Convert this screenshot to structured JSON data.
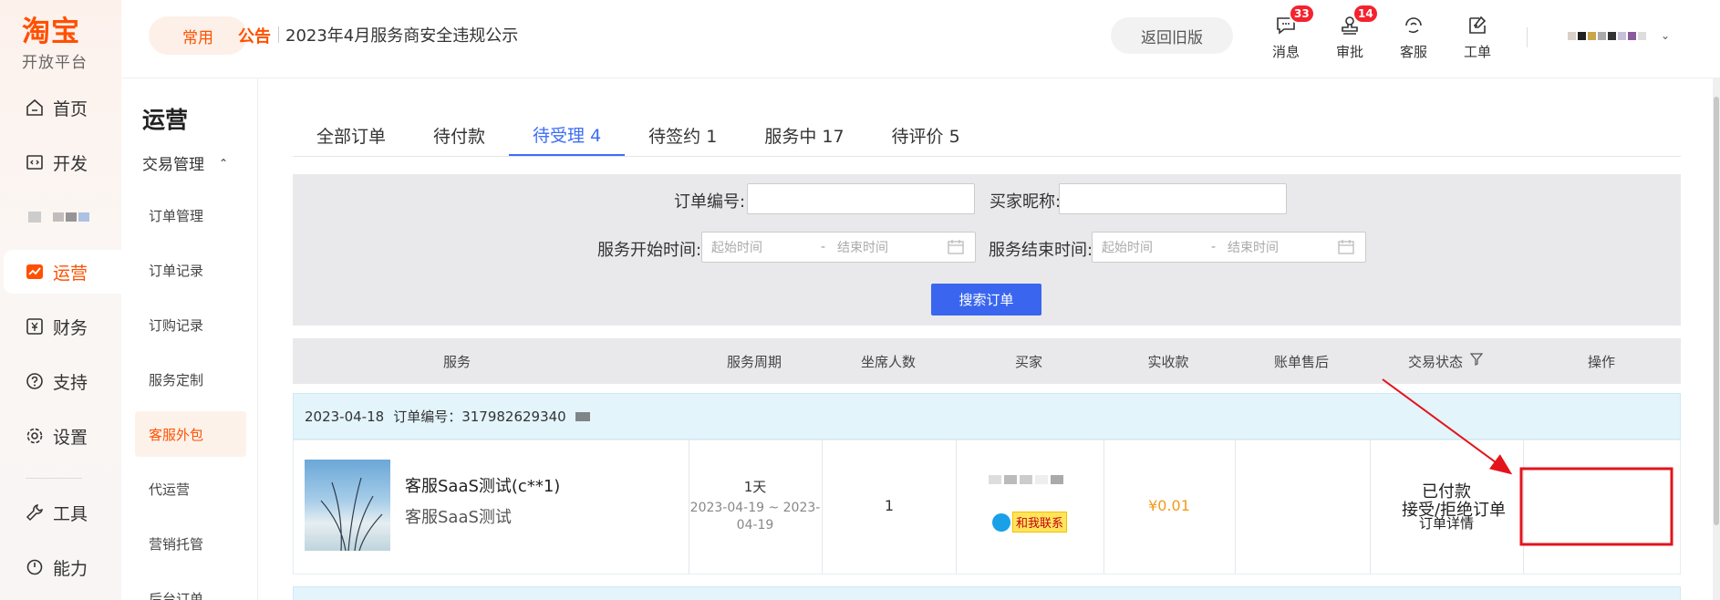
{
  "logo": {
    "main": "淘宝",
    "sub": "开放平台"
  },
  "nav": {
    "items": [
      {
        "label": "首页",
        "icon": "home-icon"
      },
      {
        "label": "开发",
        "icon": "code-icon"
      },
      {
        "label": "",
        "icon": "blurred-icon"
      },
      {
        "label": "运营",
        "icon": "chart-icon",
        "active": true
      },
      {
        "label": "财务",
        "icon": "yen-icon"
      },
      {
        "label": "支持",
        "icon": "help-icon"
      },
      {
        "label": "设置",
        "icon": "gear-icon"
      },
      {
        "label": "工具",
        "icon": "wrench-icon"
      },
      {
        "label": "能力",
        "icon": "power-icon"
      }
    ]
  },
  "subnav": {
    "title": "运营",
    "group": "交易管理",
    "items": [
      "订单管理",
      "订单记录",
      "订购记录",
      "服务定制",
      "客服外包",
      "代运营",
      "营销托管",
      "后台订单"
    ]
  },
  "header": {
    "common": "常用",
    "notice_tag": "公告",
    "notice_text": "2023年4月服务商安全违规公示",
    "back_old": "返回旧版",
    "icons": [
      {
        "label": "消息",
        "badge": "33"
      },
      {
        "label": "审批",
        "badge": "14"
      },
      {
        "label": "客服",
        "badge": ""
      },
      {
        "label": "工单",
        "badge": ""
      }
    ]
  },
  "tabs": [
    "全部订单",
    "待付款",
    "待受理 4",
    "待签约 1",
    "服务中 17",
    "待评价 5"
  ],
  "filter": {
    "order_no": "订单编号:",
    "buyer_nick": "买家昵称:",
    "start_time": "服务开始时间:",
    "end_time": "服务结束时间:",
    "begin_placeholder": "起始时间",
    "end_placeholder": "结束时间",
    "search_btn": "搜索订单"
  },
  "table": {
    "headers": [
      "服务",
      "服务周期",
      "坐席人数",
      "买家",
      "实收款",
      "账单售后",
      "交易状态",
      "操作"
    ],
    "order": {
      "date": "2023-04-18",
      "order_no": "订单编号：317982629340",
      "service_name": "客服SaaS测试(c**1)",
      "service_sub": "客服SaaS测试",
      "period": "1天",
      "period_dates": "2023-04-19 ~ 2023-04-19",
      "seats": "1",
      "contact": "和我联系",
      "amount": "¥0.01",
      "status": "已付款",
      "status_link": "订单详情",
      "action": "接受/拒绝订单"
    }
  },
  "colors": {
    "brand": "#ff5000",
    "accent": "#3d6df5",
    "highlight": "#e3141c"
  }
}
